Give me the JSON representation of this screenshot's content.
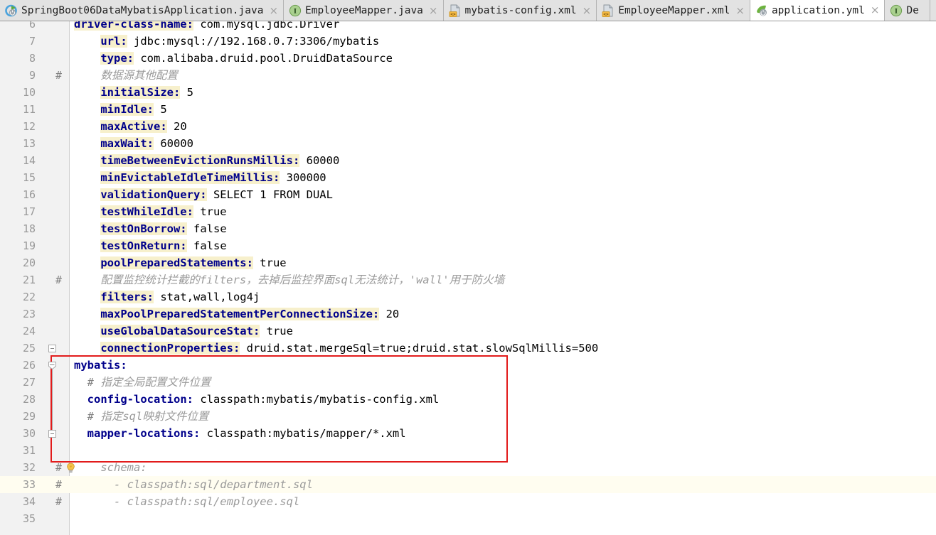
{
  "window": {
    "app": "IntelliJ IDEA Editor",
    "active_file": "application.yml"
  },
  "tabs": [
    {
      "label": "SpringBoot06DataMybatisApplication.java",
      "icon": "spring-boot-run-icon",
      "active": false,
      "close": "×"
    },
    {
      "label": "EmployeeMapper.java",
      "icon": "java-interface-icon",
      "active": false,
      "close": "×"
    },
    {
      "label": "mybatis-config.xml",
      "icon": "xml-file-icon",
      "active": false,
      "close": "×"
    },
    {
      "label": "EmployeeMapper.xml",
      "icon": "xml-file-icon",
      "active": false,
      "close": "×"
    },
    {
      "label": "application.yml",
      "icon": "spring-yaml-icon",
      "active": true,
      "close": "×"
    },
    {
      "label": "De",
      "icon": "java-interface-icon",
      "active": false,
      "close": ""
    }
  ],
  "editor": {
    "language": "yaml",
    "current_line": 33,
    "colors": {
      "key": "#00008b",
      "key_highlight_bg": "#f7f0cc",
      "value": "#000000",
      "comment": "#9a9a9a",
      "current_line_bg": "#fffdf0",
      "gutter_bg": "#f2f2f2",
      "line_number": "#999999",
      "annotation_box": "#e21b1b",
      "tab_bar_bg": "#e2e2e2",
      "active_tab_bg": "#ffffff"
    },
    "annotation": {
      "type": "red-rectangle",
      "covers_lines": [
        26,
        31
      ]
    },
    "lines": [
      {
        "num": 6,
        "clipped": true,
        "hash": "",
        "bulb": false,
        "indent": 4,
        "segments": [
          {
            "t": "driver-class-name:",
            "c": "k"
          },
          {
            "t": " com.mysql.jdbc.Driver",
            "c": "v"
          }
        ]
      },
      {
        "num": 7,
        "hash": "",
        "bulb": false,
        "segments": [
          {
            "t": "    ",
            "c": "v"
          },
          {
            "t": "url:",
            "c": "k"
          },
          {
            "t": " jdbc:mysql://192.168.0.7:3306/mybatis",
            "c": "v"
          }
        ]
      },
      {
        "num": 8,
        "hash": "",
        "bulb": false,
        "segments": [
          {
            "t": "    ",
            "c": "v"
          },
          {
            "t": "type:",
            "c": "k"
          },
          {
            "t": " com.alibaba.druid.pool.DruidDataSource",
            "c": "v"
          }
        ]
      },
      {
        "num": 9,
        "hash": "#",
        "bulb": false,
        "segments": [
          {
            "t": "    ",
            "c": "v"
          },
          {
            "t": "数据源其他配置",
            "c": "cm"
          }
        ]
      },
      {
        "num": 10,
        "hash": "",
        "bulb": false,
        "segments": [
          {
            "t": "    ",
            "c": "v"
          },
          {
            "t": "initialSize:",
            "c": "k"
          },
          {
            "t": " 5",
            "c": "v"
          }
        ]
      },
      {
        "num": 11,
        "hash": "",
        "bulb": false,
        "segments": [
          {
            "t": "    ",
            "c": "v"
          },
          {
            "t": "minIdle:",
            "c": "k"
          },
          {
            "t": " 5",
            "c": "v"
          }
        ]
      },
      {
        "num": 12,
        "hash": "",
        "bulb": false,
        "segments": [
          {
            "t": "    ",
            "c": "v"
          },
          {
            "t": "maxActive:",
            "c": "k"
          },
          {
            "t": " 20",
            "c": "v"
          }
        ]
      },
      {
        "num": 13,
        "hash": "",
        "bulb": false,
        "segments": [
          {
            "t": "    ",
            "c": "v"
          },
          {
            "t": "maxWait:",
            "c": "k"
          },
          {
            "t": " 60000",
            "c": "v"
          }
        ]
      },
      {
        "num": 14,
        "hash": "",
        "bulb": false,
        "segments": [
          {
            "t": "    ",
            "c": "v"
          },
          {
            "t": "timeBetweenEvictionRunsMillis:",
            "c": "k"
          },
          {
            "t": " 60000",
            "c": "v"
          }
        ]
      },
      {
        "num": 15,
        "hash": "",
        "bulb": false,
        "segments": [
          {
            "t": "    ",
            "c": "v"
          },
          {
            "t": "minEvictableIdleTimeMillis:",
            "c": "k"
          },
          {
            "t": " 300000",
            "c": "v"
          }
        ]
      },
      {
        "num": 16,
        "hash": "",
        "bulb": false,
        "segments": [
          {
            "t": "    ",
            "c": "v"
          },
          {
            "t": "validationQuery:",
            "c": "k"
          },
          {
            "t": " SELECT 1 FROM DUAL",
            "c": "v"
          }
        ]
      },
      {
        "num": 17,
        "hash": "",
        "bulb": false,
        "segments": [
          {
            "t": "    ",
            "c": "v"
          },
          {
            "t": "testWhileIdle:",
            "c": "k"
          },
          {
            "t": " true",
            "c": "v"
          }
        ]
      },
      {
        "num": 18,
        "hash": "",
        "bulb": false,
        "segments": [
          {
            "t": "    ",
            "c": "v"
          },
          {
            "t": "testOnBorrow:",
            "c": "k"
          },
          {
            "t": " false",
            "c": "v"
          }
        ]
      },
      {
        "num": 19,
        "hash": "",
        "bulb": false,
        "segments": [
          {
            "t": "    ",
            "c": "v"
          },
          {
            "t": "testOnReturn:",
            "c": "k"
          },
          {
            "t": " false",
            "c": "v"
          }
        ]
      },
      {
        "num": 20,
        "hash": "",
        "bulb": false,
        "segments": [
          {
            "t": "    ",
            "c": "v"
          },
          {
            "t": "poolPreparedStatements:",
            "c": "k"
          },
          {
            "t": " true",
            "c": "v"
          }
        ]
      },
      {
        "num": 21,
        "hash": "#",
        "bulb": false,
        "segments": [
          {
            "t": "    ",
            "c": "v"
          },
          {
            "t": "配置监控统计拦截的filters，去掉后监控界面sql无法统计，'wall'用于防火墙",
            "c": "cm"
          }
        ]
      },
      {
        "num": 22,
        "hash": "",
        "bulb": false,
        "segments": [
          {
            "t": "    ",
            "c": "v"
          },
          {
            "t": "filters:",
            "c": "k"
          },
          {
            "t": " stat,wall,log4j",
            "c": "v"
          }
        ]
      },
      {
        "num": 23,
        "hash": "",
        "bulb": false,
        "segments": [
          {
            "t": "    ",
            "c": "v"
          },
          {
            "t": "maxPoolPreparedStatementPerConnectionSize:",
            "c": "k"
          },
          {
            "t": " 20",
            "c": "v"
          }
        ]
      },
      {
        "num": 24,
        "hash": "",
        "bulb": false,
        "segments": [
          {
            "t": "    ",
            "c": "v"
          },
          {
            "t": "useGlobalDataSourceStat:",
            "c": "k"
          },
          {
            "t": " true",
            "c": "v"
          }
        ]
      },
      {
        "num": 25,
        "hash": "",
        "bulb": false,
        "segments": [
          {
            "t": "    ",
            "c": "v"
          },
          {
            "t": "connectionProperties:",
            "c": "k"
          },
          {
            "t": " druid.stat.mergeSql=true;druid.stat.slowSqlMillis=500",
            "c": "v"
          }
        ]
      },
      {
        "num": 26,
        "hash": "",
        "bulb": false,
        "segments": [
          {
            "t": "mybatis:",
            "c": "k-nohl"
          }
        ]
      },
      {
        "num": 27,
        "hash": "",
        "bulb": false,
        "segments": [
          {
            "t": "  # ",
            "c": "cm-dark"
          },
          {
            "t": "指定全局配置文件位置",
            "c": "cm"
          }
        ]
      },
      {
        "num": 28,
        "hash": "",
        "bulb": false,
        "segments": [
          {
            "t": "  ",
            "c": "v"
          },
          {
            "t": "config-location:",
            "c": "k-nohl"
          },
          {
            "t": " classpath:mybatis/mybatis-config.xml",
            "c": "v"
          }
        ]
      },
      {
        "num": 29,
        "hash": "",
        "bulb": false,
        "segments": [
          {
            "t": "  # ",
            "c": "cm-dark"
          },
          {
            "t": "指定sql映射文件位置",
            "c": "cm"
          }
        ]
      },
      {
        "num": 30,
        "hash": "",
        "bulb": false,
        "segments": [
          {
            "t": "  ",
            "c": "v"
          },
          {
            "t": "mapper-locations:",
            "c": "k-nohl"
          },
          {
            "t": " classpath:mybatis/mapper/*.xml",
            "c": "v"
          }
        ]
      },
      {
        "num": 31,
        "hash": "",
        "bulb": false,
        "segments": []
      },
      {
        "num": 32,
        "hash": "#",
        "bulb": true,
        "segments": [
          {
            "t": "    schema:",
            "c": "cm"
          }
        ]
      },
      {
        "num": 33,
        "hash": "#",
        "bulb": false,
        "current": true,
        "segments": [
          {
            "t": "      - classpath:sql/department.sql",
            "c": "cm"
          }
        ]
      },
      {
        "num": 34,
        "hash": "#",
        "bulb": false,
        "segments": [
          {
            "t": "      - classpath:sql/employee.sql",
            "c": "cm"
          }
        ]
      },
      {
        "num": 35,
        "hash": "",
        "bulb": false,
        "segments": []
      }
    ],
    "fold_markers": [
      {
        "line": 25,
        "type": "collapse-square"
      },
      {
        "line": 26,
        "type": "collapse-arrow"
      },
      {
        "line": 30,
        "type": "collapse-square"
      }
    ]
  }
}
